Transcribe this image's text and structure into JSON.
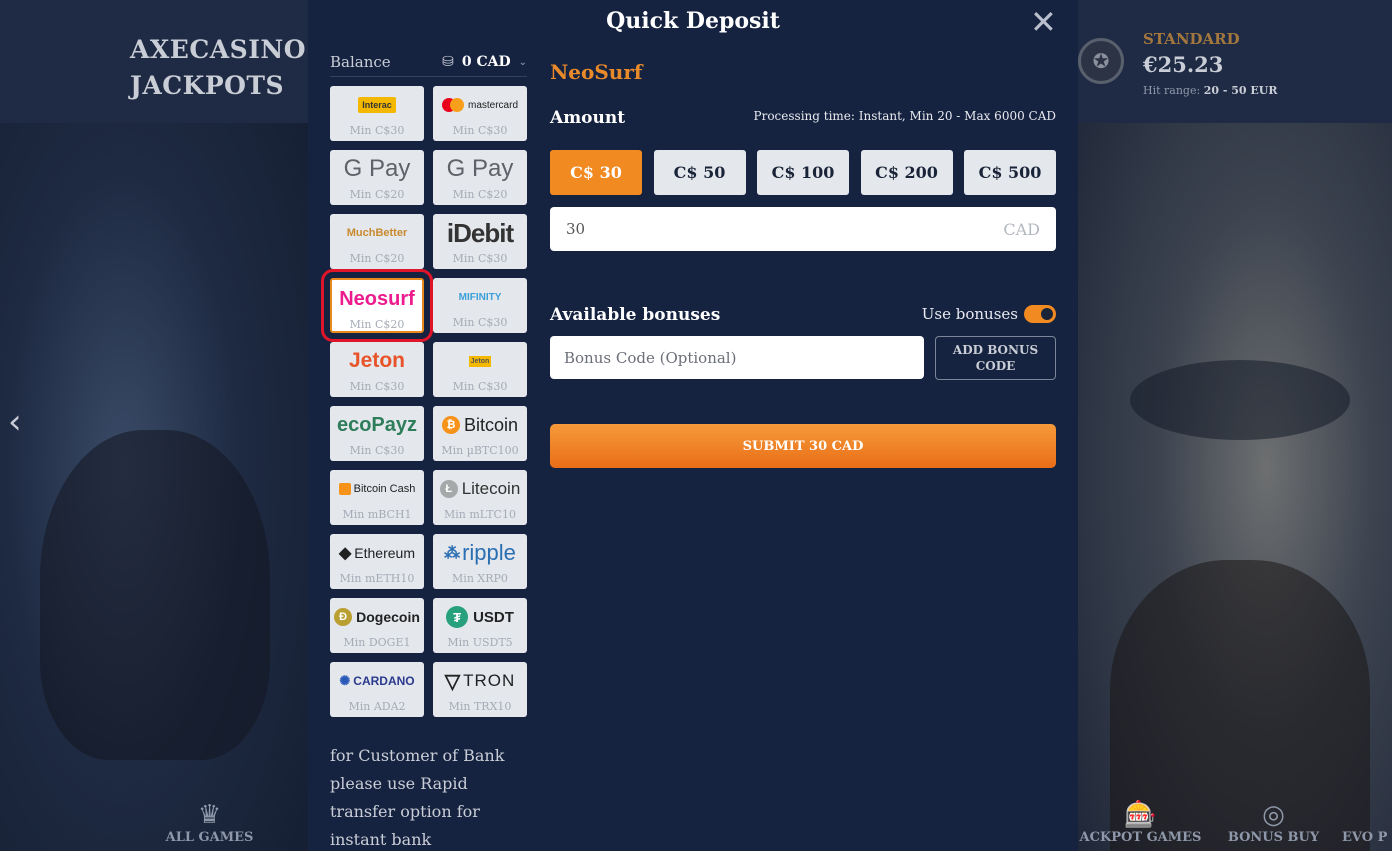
{
  "brand": {
    "line1": "AXECASINO",
    "line2": "JACKPOTS"
  },
  "jackpot": {
    "label": "STANDARD",
    "amount": "€25.23",
    "range_label": "Hit range:",
    "range_value": "20 - 50 EUR"
  },
  "nav": {
    "left": "ALL GAMES",
    "right1": "ACKPOT GAMES",
    "right2": "BONUS BUY",
    "right3": "EVO P"
  },
  "modal": {
    "title": "Quick Deposit",
    "balance_label": "Balance",
    "balance_value": "0 CAD",
    "note": "for Customer of Bank please use Rapid transfer option for instant bank",
    "methods": [
      {
        "name": "Interac",
        "min": "Min C$30"
      },
      {
        "name": "mastercard",
        "min": "Min C$30"
      },
      {
        "name": "G Pay",
        "min": "Min C$20"
      },
      {
        "name": "G Pay",
        "min": "Min C$20"
      },
      {
        "name": "MuchBetter",
        "min": "Min C$20"
      },
      {
        "name": "iDebit",
        "min": "Min C$30"
      },
      {
        "name": "Neosurf",
        "min": "Min C$20"
      },
      {
        "name": "MIFINITY",
        "min": "Min C$30"
      },
      {
        "name": "Jeton",
        "min": "Min C$30"
      },
      {
        "name": "Jeton",
        "min": "Min C$30"
      },
      {
        "name": "ecoPayz",
        "min": "Min C$30"
      },
      {
        "name": "Bitcoin",
        "min": "Min µBTC100"
      },
      {
        "name": "Bitcoin Cash",
        "min": "Min mBCH1"
      },
      {
        "name": "Litecoin",
        "min": "Min mLTC10"
      },
      {
        "name": "Ethereum",
        "min": "Min mETH10"
      },
      {
        "name": "ripple",
        "min": "Min XRP0"
      },
      {
        "name": "Dogecoin",
        "min": "Min DOGE1"
      },
      {
        "name": "USDT",
        "min": "Min USDT5"
      },
      {
        "name": "CARDANO",
        "min": "Min ADA2"
      },
      {
        "name": "TRON",
        "min": "Min TRX10"
      }
    ],
    "selected_method": "NeoSurf",
    "amount_label": "Amount",
    "processing": "Processing time: Instant, Min 20 - Max 6000 CAD",
    "presets": [
      "C$ 30",
      "C$ 50",
      "C$ 100",
      "C$ 200",
      "C$ 500"
    ],
    "amount_value": "30",
    "amount_currency": "CAD",
    "bonuses_label": "Available bonuses",
    "use_bonuses_label": "Use bonuses",
    "bonus_placeholder": "Bonus Code (Optional)",
    "add_bonus_label": "ADD BONUS CODE",
    "submit_label": "SUBMIT 30 CAD"
  },
  "colors": {
    "accent": "#f28a22",
    "modal_bg": "#162340",
    "highlight": "#e0152a"
  }
}
